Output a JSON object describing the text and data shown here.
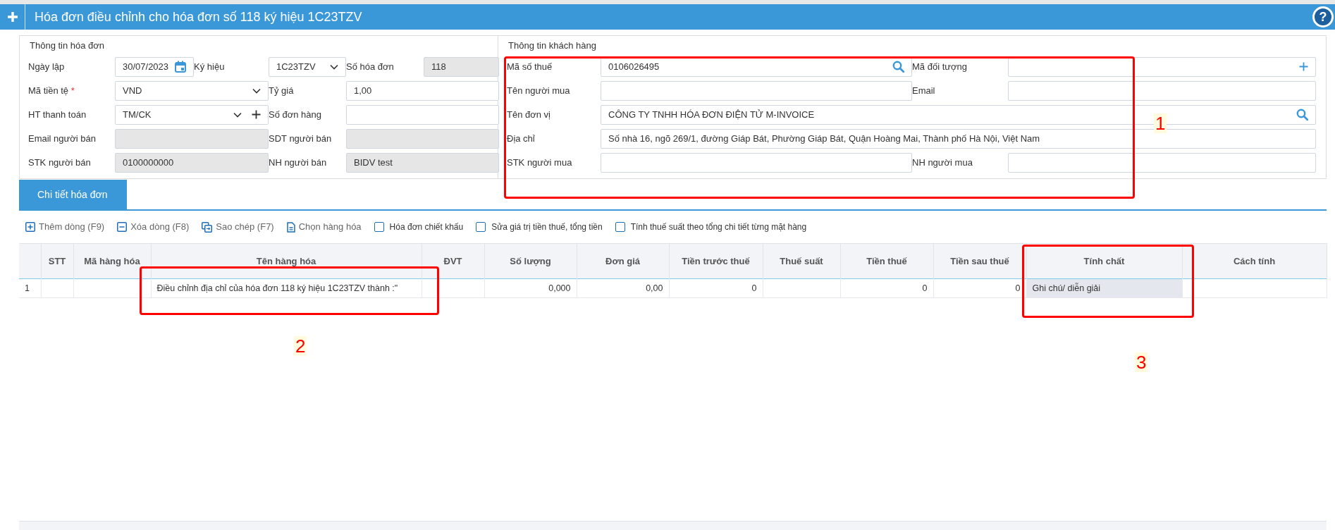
{
  "header": {
    "title": "Hóa đơn điều chỉnh cho hóa đơn số 118 ký hiệu 1C23TZV",
    "help_glyph": "?"
  },
  "invoice_info": {
    "legend": "Thông tin hóa đơn",
    "rows": [
      [
        {
          "label": "Ngày lập",
          "value": "30/07/2023",
          "kind": "date",
          "disabled": false
        },
        {
          "label": "Ký hiệu",
          "value": "1C23TZV",
          "kind": "select",
          "disabled": false
        },
        {
          "label": "Số hóa đơn",
          "value": "118",
          "kind": "text",
          "disabled": true
        }
      ],
      [
        {
          "label": "Mã tiền tệ",
          "required": true,
          "required_mark": "*",
          "value": "VND",
          "kind": "select",
          "disabled": false
        },
        {
          "label": "Tỷ giá",
          "value": "1,00",
          "kind": "text",
          "disabled": false
        }
      ],
      [
        {
          "label": "HT thanh toán",
          "value": "TM/CK",
          "kind": "select-add",
          "disabled": false
        },
        {
          "label": "Số đơn hàng",
          "kind": "text",
          "disabled": false
        }
      ],
      [
        {
          "label": "Email người bán",
          "kind": "text",
          "disabled": true
        },
        {
          "label": "SDT người bán",
          "kind": "text",
          "disabled": true
        }
      ],
      [
        {
          "label": "STK người bán",
          "value": "0100000000",
          "kind": "text",
          "disabled": true
        },
        {
          "label": "NH người bán",
          "value": "BIDV test",
          "kind": "text",
          "disabled": true
        }
      ]
    ]
  },
  "customer_info": {
    "legend": "Thông tin khách hàng",
    "rows": [
      [
        {
          "label": "Mã số thuế",
          "value": "0106026495",
          "kind": "search"
        },
        {
          "label": "Mã đối tượng",
          "kind": "add"
        }
      ],
      [
        {
          "label": "Tên người mua",
          "kind": "text"
        },
        {
          "label": "Email",
          "kind": "text"
        }
      ],
      [
        {
          "label": "Tên đơn vị",
          "value": "CÔNG TY TNHH HÓA ĐƠN ĐIỆN TỬ M-INVOICE",
          "kind": "search"
        }
      ],
      [
        {
          "label": "Địa chỉ",
          "value": "Số nhà 16, ngõ 269/1, đường Giáp Bát, Phường Giáp Bát, Quận Hoàng Mai, Thành phố Hà Nội, Việt Nam",
          "kind": "text"
        }
      ],
      [
        {
          "label": "STK người mua",
          "kind": "text"
        },
        {
          "label": "NH người mua",
          "kind": "text"
        }
      ]
    ]
  },
  "tabs": [
    {
      "label": "Chi tiết hóa đơn",
      "selected": true
    }
  ],
  "toolbar": [
    {
      "kind": "button",
      "label": "Thêm dòng (F9)"
    },
    {
      "kind": "button",
      "label": "Xóa dòng (F8)"
    },
    {
      "kind": "button",
      "label": "Sao chép (F7)"
    },
    {
      "kind": "button",
      "label": "Chọn hàng hóa"
    },
    {
      "kind": "checkbox",
      "label": "Hóa đơn chiết khấu",
      "checked": false
    },
    {
      "kind": "checkbox",
      "label": "Sửa giá trị tiền thuế, tổng tiền",
      "checked": false
    },
    {
      "kind": "checkbox",
      "label": "Tính thuế suất theo tổng chi tiết từng mặt hàng",
      "checked": false
    }
  ],
  "table": {
    "columns": [
      {
        "kind": "text"
      },
      {
        "label": "STT",
        "kind": "text"
      },
      {
        "label": "Mã hàng hóa",
        "kind": "text"
      },
      {
        "label": "Tên hàng hóa",
        "kind": "text"
      },
      {
        "label": "ĐVT",
        "kind": "text"
      },
      {
        "label": "Số lượng",
        "kind": "number"
      },
      {
        "label": "Đơn giá",
        "kind": "number"
      },
      {
        "label": "Tiền trước thuế",
        "kind": "number"
      },
      {
        "label": "Thuế suất",
        "kind": "number"
      },
      {
        "label": "Tiền thuế",
        "kind": "number"
      },
      {
        "label": "Tiền sau thuế",
        "kind": "number"
      },
      {
        "label": "Tính chất",
        "kind": "select"
      },
      {
        "label": "Cách tính",
        "kind": "text"
      }
    ],
    "rows": [
      {
        "cells": [
          "1",
          null,
          null,
          "Điều chỉnh địa chỉ của hóa đơn 118 ký hiệu 1C23TZV thành :\"",
          null,
          "0,000",
          "0,00",
          "0",
          null,
          "0",
          "0",
          "Ghi chú/ diễn giải",
          null
        ]
      }
    ]
  },
  "annotations": [
    {
      "label": "1"
    },
    {
      "label": "2"
    },
    {
      "label": "3"
    }
  ]
}
